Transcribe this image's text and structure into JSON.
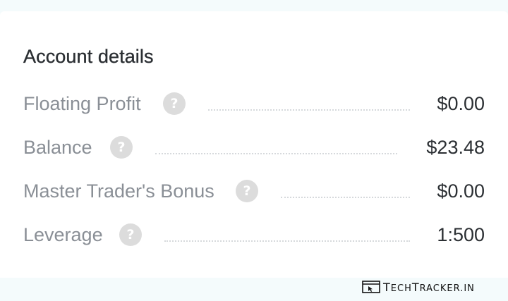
{
  "section": {
    "title": "Account details"
  },
  "rows": [
    {
      "label": "Floating Profit",
      "help": "?",
      "value": "$0.00"
    },
    {
      "label": "Balance",
      "help": "?",
      "value": "$23.48"
    },
    {
      "label": "Master Trader's Bonus",
      "help": "?",
      "value": "$0.00"
    },
    {
      "label": "Leverage",
      "help": "?",
      "value": "1:500"
    }
  ],
  "watermark": {
    "text_first": "T",
    "text_mid1": "ECH",
    "text_second": "T",
    "text_mid2": "RACKER.IN"
  },
  "icons": {
    "help": "question-circle-icon",
    "watermark_logo": "browser-cursor-icon"
  },
  "colors": {
    "label": "#8a8f96",
    "value": "#2b2f33",
    "help_bg": "#dcdcdc",
    "background": "#f4fbfc"
  }
}
